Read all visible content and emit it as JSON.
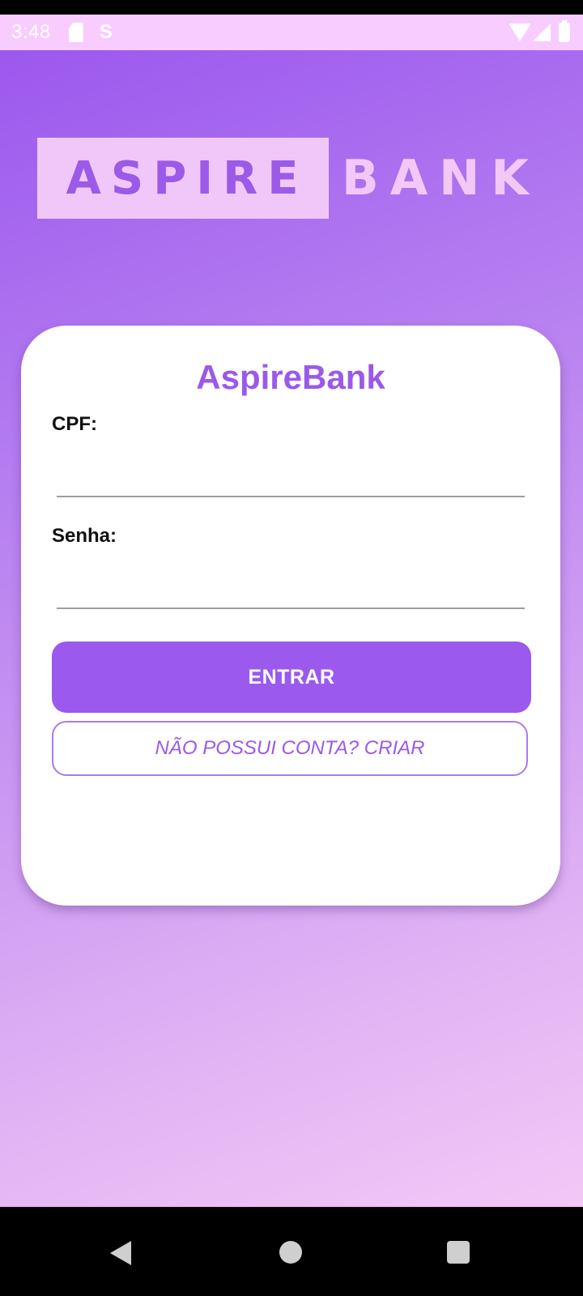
{
  "status_bar": {
    "time": "3:48",
    "icons": [
      "sim-card-icon",
      "s-notification-icon",
      "wifi-icon",
      "signal-icon",
      "battery-icon"
    ]
  },
  "logo": {
    "word1": "ASPIRE",
    "word2": "BANK"
  },
  "login_card": {
    "title": "AspireBank",
    "cpf_label": "CPF:",
    "cpf_value": "",
    "senha_label": "Senha:",
    "senha_value": "",
    "enter_button": "ENTRAR",
    "create_account_button": "NÃO POSSUI CONTA? CRIAR"
  },
  "nav_bar": {
    "icons": [
      "back-icon",
      "home-icon",
      "recents-icon"
    ]
  },
  "colors": {
    "accent": "#9b59ee",
    "card_background": "#ffffff",
    "gradient_top": "#9c58ee",
    "gradient_bottom": "#f3c8f6",
    "logo_box": "#f1c7f9"
  }
}
